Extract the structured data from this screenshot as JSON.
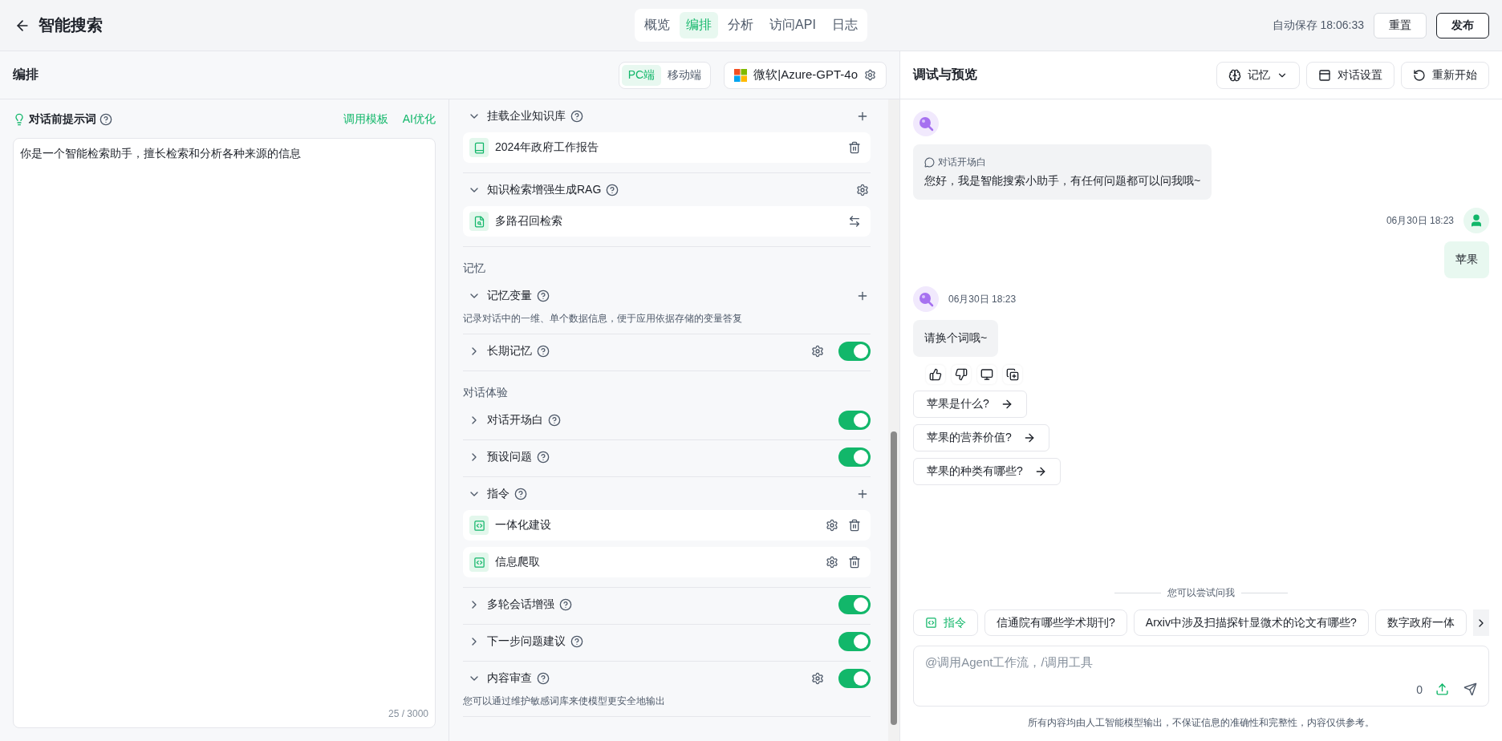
{
  "header": {
    "title": "智能搜索",
    "tabs": [
      {
        "label": "概览",
        "selected": false
      },
      {
        "label": "编排",
        "selected": true
      },
      {
        "label": "分析",
        "selected": false
      },
      {
        "label": "访问API",
        "selected": false
      },
      {
        "label": "日志",
        "selected": false
      }
    ],
    "autosave": "自动保存 18:06:33",
    "buttons": [
      {
        "label": "重置",
        "kind": "secondary"
      },
      {
        "label": "发布",
        "kind": "primary"
      }
    ]
  },
  "editor": {
    "title": "编排",
    "platforms": [
      {
        "label": "PC端",
        "selected": true
      },
      {
        "label": "移动端",
        "selected": false
      }
    ],
    "model": "微软|Azure-GPT-4o"
  },
  "prompt": {
    "title": "对话前提示词",
    "actions": [
      "调用模板",
      "AI优化"
    ],
    "value": "你是一个智能检索助手，擅长检索和分析各种来源的信息",
    "counter": "25 / 3000"
  },
  "config": [
    {
      "kind": "section",
      "label": "挂载企业知识库",
      "expanded": true,
      "can_add": true,
      "items": [
        {
          "label": "2024年政府工作报告",
          "kind": "document"
        }
      ]
    },
    {
      "kind": "section",
      "label": "知识检索增强生成RAG",
      "expanded": true,
      "has_settings": true,
      "items": [
        {
          "label": "多路召回检索",
          "kind": "retrieval"
        }
      ]
    },
    {
      "kind": "group",
      "label": "记忆"
    },
    {
      "kind": "section",
      "label": "记忆变量",
      "expanded": true,
      "can_add": true,
      "description": "记录对话中的一维、单个数据信息，便于应用依据存储的变量答复"
    },
    {
      "kind": "section",
      "label": "长期记忆",
      "expanded": false,
      "has_settings": true,
      "on": true
    },
    {
      "kind": "group",
      "label": "对话体验"
    },
    {
      "kind": "section",
      "label": "对话开场白",
      "expanded": false,
      "on": true
    },
    {
      "kind": "section",
      "label": "预设问题",
      "expanded": false,
      "on": true
    },
    {
      "kind": "section",
      "label": "指令",
      "expanded": true,
      "can_add": true,
      "items": [
        {
          "label": "一体化建设",
          "kind": "command"
        },
        {
          "label": "信息爬取",
          "kind": "command"
        }
      ]
    },
    {
      "kind": "section",
      "label": "多轮会话增强",
      "expanded": false,
      "on": true
    },
    {
      "kind": "section",
      "label": "下一步问题建议",
      "expanded": false,
      "on": true
    },
    {
      "kind": "section",
      "label": "内容审查",
      "expanded": true,
      "has_settings": true,
      "on": true,
      "description": "您可以通过维护敏感词库来使模型更安全地输出"
    }
  ],
  "preview": {
    "title": "调试与预览",
    "buttons": [
      {
        "label": "记忆",
        "kind": "memory"
      },
      {
        "label": "对话设置",
        "kind": "settings"
      },
      {
        "label": "重新开始",
        "kind": "restart"
      }
    ],
    "messages": [
      {
        "kind": "bot",
        "caption": "对话开场白",
        "text": "您好，我是智能搜索小助手，有任何问题都可以问我哦~"
      },
      {
        "kind": "user",
        "time": "06月30日 18:23",
        "text": "苹果"
      },
      {
        "kind": "bot",
        "time": "06月30日 18:23",
        "text": "请换个词哦~",
        "feedback": true,
        "suggestions": [
          "苹果是什么?",
          "苹果的营养价值?",
          "苹果的种类有哪些?"
        ]
      }
    ],
    "try_label": "您可以尝试问我",
    "chips": [
      {
        "label": "指令",
        "kind": "command"
      },
      {
        "label": "信通院有哪些学术期刊?",
        "kind": "question"
      },
      {
        "label": "Arxiv中涉及扫描探针显微术的论文有哪些?",
        "kind": "question"
      },
      {
        "label": "数字政府一体",
        "kind": "question"
      }
    ],
    "input": {
      "placeholder": "@调用Agent工作流，/调用工具",
      "counter": "0"
    },
    "disclaimer": "所有内容均由人工智能模型输出，不保证信息的准确性和完整性，内容仅供参考。"
  }
}
